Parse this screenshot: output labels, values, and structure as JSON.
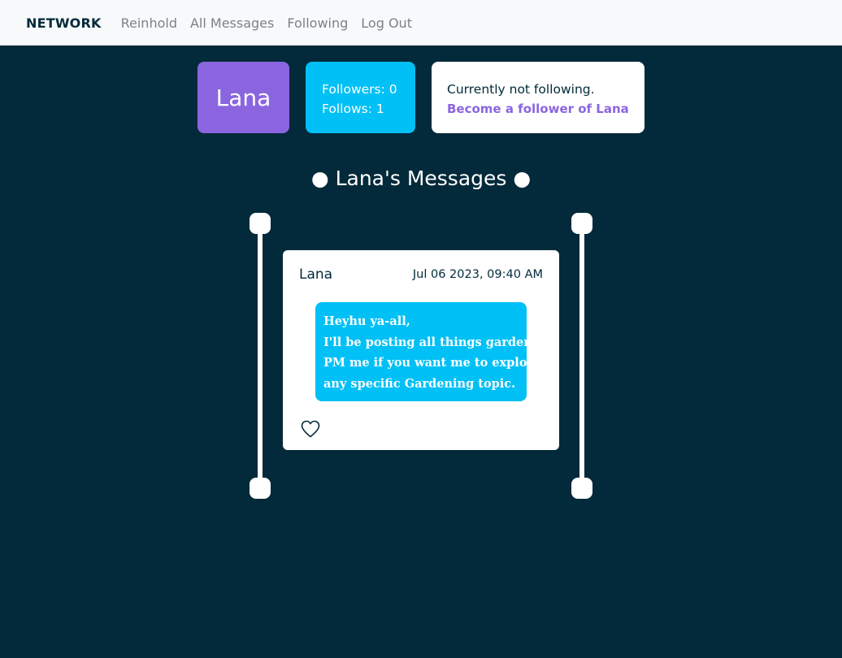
{
  "nav": {
    "brand": "NETWORK",
    "links": [
      "Reinhold",
      "All Messages",
      "Following",
      "Log Out"
    ]
  },
  "profile": {
    "name": "Lana",
    "followers_label": "Followers: 0",
    "follows_label": "Follows: 1",
    "status_text": "Currently not following.",
    "follow_action": "Become a follower of Lana"
  },
  "messages": {
    "heading": "● Lana's Messages ●",
    "items": [
      {
        "author": "Lana",
        "timestamp": "Jul 06 2023, 09:40 AM",
        "body_lines": [
          "Heyhu ya-all,",
          "I'll be posting all things gardening.",
          "PM me if you want me to explore",
          "any specific Gardening topic."
        ],
        "like_icon": "heart-outline-icon"
      }
    ]
  },
  "colors": {
    "background": "#022a3a",
    "navbar": "#f8f9fa",
    "accent_purple": "#8b65e0",
    "accent_cyan": "#00c0f5"
  }
}
